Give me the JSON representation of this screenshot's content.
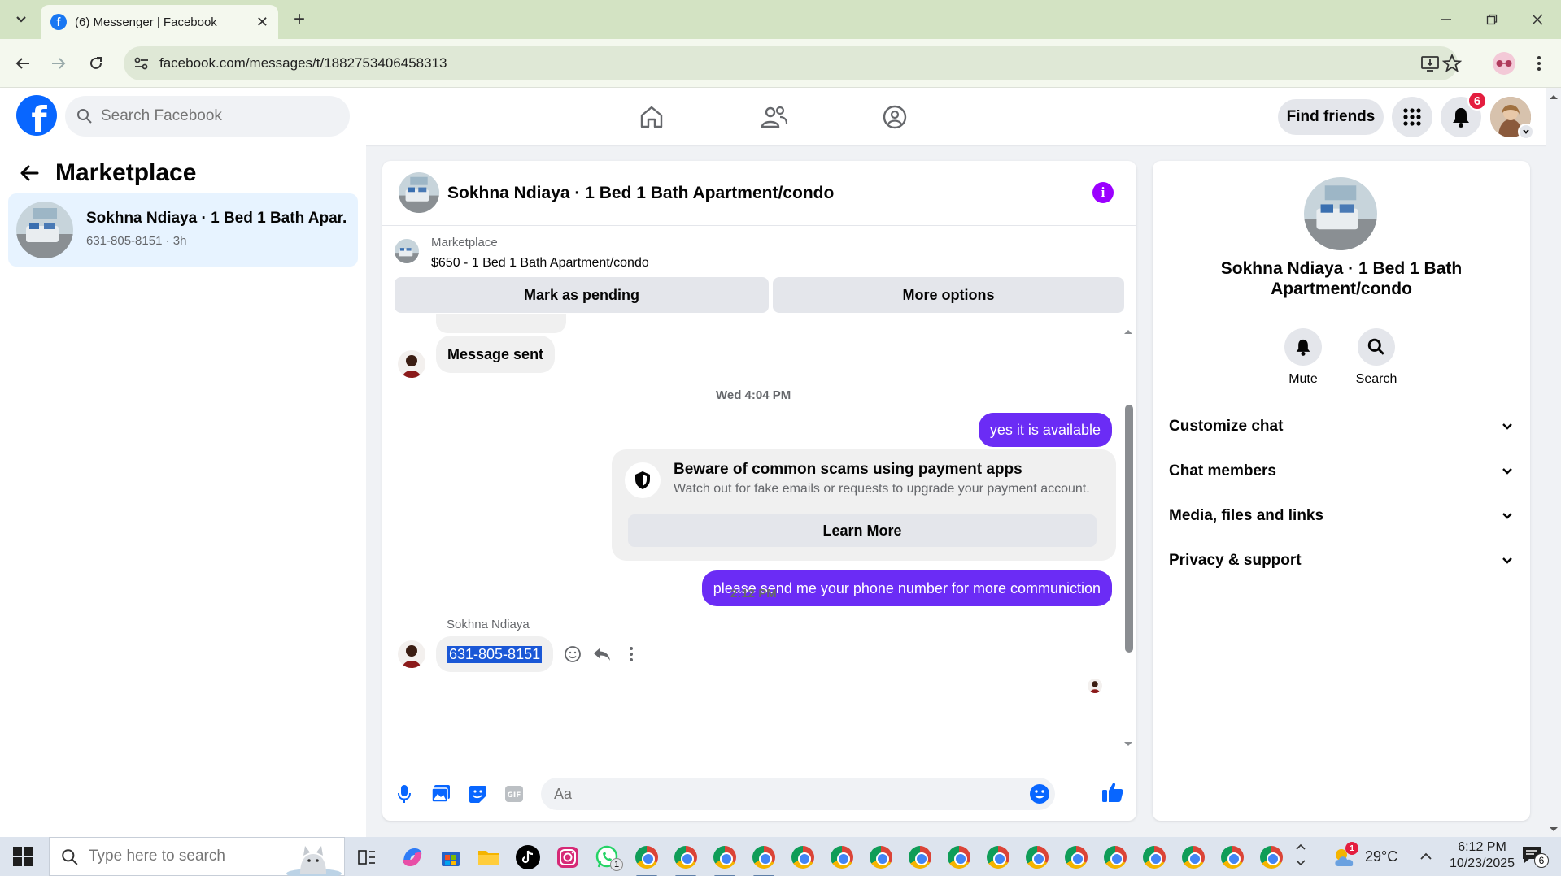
{
  "browser": {
    "tab_title": "(6) Messenger | Facebook",
    "url": "facebook.com/messages/t/1882753406458313"
  },
  "fb": {
    "search_placeholder": "Search Facebook",
    "find_friends": "Find friends",
    "notif_count": "6"
  },
  "sidebar": {
    "title": "Marketplace",
    "conversation": {
      "name": "Sokhna Ndiaya · 1 Bed 1 Bath Apar...",
      "sub": "631-805-8151 · 3h"
    }
  },
  "chat": {
    "title": "Sokhna Ndiaya · 1 Bed 1 Bath Apartment/condo",
    "listing_label": "Marketplace",
    "listing_desc": "$650 - 1 Bed 1 Bath Apartment/condo",
    "mark_pending": "Mark as pending",
    "more_options": "More options",
    "msg_sent": "Message sent",
    "ts1": "Wed 4:04 PM",
    "out1": "yes it is available",
    "scam_title": "Beware of common scams using payment apps",
    "scam_desc": "Watch out for fake emails or requests to upgrade your payment account.",
    "learn_more": "Learn More",
    "out2": "please send me your phone number for more communiction",
    "ts2": "2:12 PM",
    "sender_name": "Sokhna Ndiaya",
    "phone_msg": "631-805-8151",
    "composer_placeholder": "Aa"
  },
  "info": {
    "name": "Sokhna Ndiaya · 1 Bed 1 Bath Apartment/condo",
    "mute": "Mute",
    "search": "Search",
    "sections": [
      "Customize chat",
      "Chat members",
      "Media, files and links",
      "Privacy & support"
    ]
  },
  "taskbar": {
    "search_placeholder": "Type here to search",
    "weather": "29°C",
    "time": "6:12 PM",
    "date": "10/23/2025",
    "notif": "6",
    "whatsapp_badge": "1",
    "weather_badge": "1"
  },
  "colors": {
    "fb_blue": "#0866ff",
    "messenger_purple": "#6b2cf5",
    "info_purple": "#9b00ff",
    "selected_conv": "#e7f3ff"
  }
}
